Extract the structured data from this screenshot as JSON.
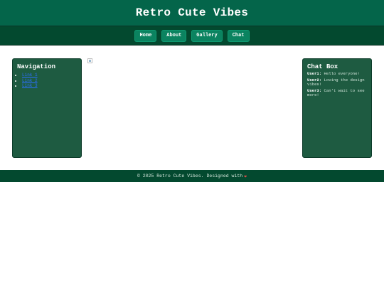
{
  "header": {
    "title": "Retro Cute Vibes"
  },
  "nav": {
    "items": [
      {
        "label": "Home"
      },
      {
        "label": "About"
      },
      {
        "label": "Gallery"
      },
      {
        "label": "Chat"
      }
    ]
  },
  "sidebar_left": {
    "title": "Navigation",
    "links": [
      {
        "label": "Link 1"
      },
      {
        "label": "Link 2"
      },
      {
        "label": "Link 3"
      }
    ]
  },
  "sidebar_right": {
    "title": "Chat Box",
    "messages": [
      {
        "user": "User1:",
        "text": "Hello everyone!"
      },
      {
        "user": "User2:",
        "text": "Loving the design vibes!"
      },
      {
        "user": "User3:",
        "text": "Can't wait to see more!"
      }
    ]
  },
  "footer": {
    "text": "© 2025 Retro Cute Vibes. Designed with",
    "heart": "❤"
  },
  "colors": {
    "header_bg": "#04654a",
    "nav_bg": "#03492f",
    "button_bg": "#0b8360",
    "panel_bg": "#1e5b41",
    "link": "#2b6fff",
    "heart": "#e0504a"
  }
}
